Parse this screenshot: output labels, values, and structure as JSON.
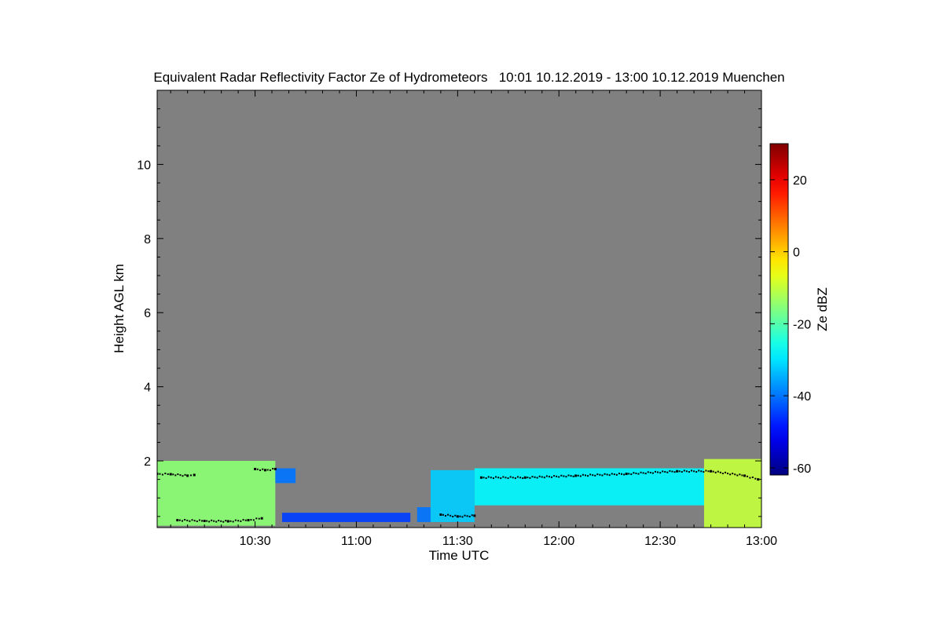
{
  "chart_data": {
    "type": "heatmap",
    "title": "Equivalent Radar Reflectivity Factor Ze of Hydrometeors   10:01 10.12.2019 - 13:00 10.12.2019 Muenchen",
    "xlabel": "Time UTC",
    "ylabel": "Height AGL km",
    "xlim": [
      "10:01",
      "13:00"
    ],
    "x_ticks": [
      "10:30",
      "11:00",
      "11:30",
      "12:00",
      "12:30",
      "13:00"
    ],
    "ylim": [
      0.2,
      12.0
    ],
    "y_ticks": [
      2,
      4,
      6,
      8,
      10
    ],
    "background_color": "#808080",
    "grid": false,
    "colorbar": {
      "label": "Ze dBZ",
      "range": [
        -62,
        30
      ],
      "ticks": [
        -60,
        -40,
        -20,
        0,
        20
      ],
      "colormap": "jet"
    },
    "echo_regions": [
      {
        "t_start": "10:01",
        "t_end": "10:36",
        "height_bottom_km": 0.25,
        "height_top_km": 2.0,
        "ze_dbz_typical": -15
      },
      {
        "t_start": "10:36",
        "t_end": "10:42",
        "height_bottom_km": 1.4,
        "height_top_km": 1.8,
        "ze_dbz_typical": -40
      },
      {
        "t_start": "10:38",
        "t_end": "11:16",
        "height_bottom_km": 0.35,
        "height_top_km": 0.6,
        "ze_dbz_typical": -45
      },
      {
        "t_start": "11:18",
        "t_end": "11:22",
        "height_bottom_km": 0.35,
        "height_top_km": 0.75,
        "ze_dbz_typical": -40
      },
      {
        "t_start": "11:22",
        "t_end": "11:35",
        "height_bottom_km": 0.35,
        "height_top_km": 1.75,
        "ze_dbz_typical": -32
      },
      {
        "t_start": "11:35",
        "t_end": "12:43",
        "height_bottom_km": 0.8,
        "height_top_km": 1.8,
        "ze_dbz_typical": -28
      },
      {
        "t_start": "12:43",
        "t_end": "13:00",
        "height_bottom_km": 0.2,
        "height_top_km": 2.05,
        "ze_dbz_typical": -10
      }
    ],
    "marker_layers": [
      {
        "name": "",
        "points": [
          [
            "10:01",
            1.65
          ],
          [
            "10:05",
            1.64
          ],
          [
            "10:10",
            1.6
          ],
          [
            "10:12",
            1.62
          ]
        ]
      },
      {
        "name": "",
        "points": [
          [
            "10:07",
            0.4
          ],
          [
            "10:15",
            0.38
          ],
          [
            "10:22",
            0.37
          ],
          [
            "10:28",
            0.4
          ],
          [
            "10:32",
            0.45
          ]
        ]
      },
      {
        "name": "",
        "points": [
          [
            "10:30",
            1.78
          ],
          [
            "10:33",
            1.75
          ],
          [
            "10:36",
            1.78
          ]
        ]
      },
      {
        "name": "",
        "points": [
          [
            "11:25",
            0.55
          ],
          [
            "11:30",
            0.5
          ],
          [
            "11:35",
            0.52
          ]
        ]
      },
      {
        "name": "",
        "points": [
          [
            "11:37",
            1.55
          ],
          [
            "11:50",
            1.55
          ],
          [
            "12:05",
            1.6
          ],
          [
            "12:20",
            1.65
          ],
          [
            "12:35",
            1.72
          ],
          [
            "12:45",
            1.72
          ],
          [
            "12:55",
            1.6
          ],
          [
            "12:59",
            1.5
          ]
        ]
      }
    ]
  }
}
